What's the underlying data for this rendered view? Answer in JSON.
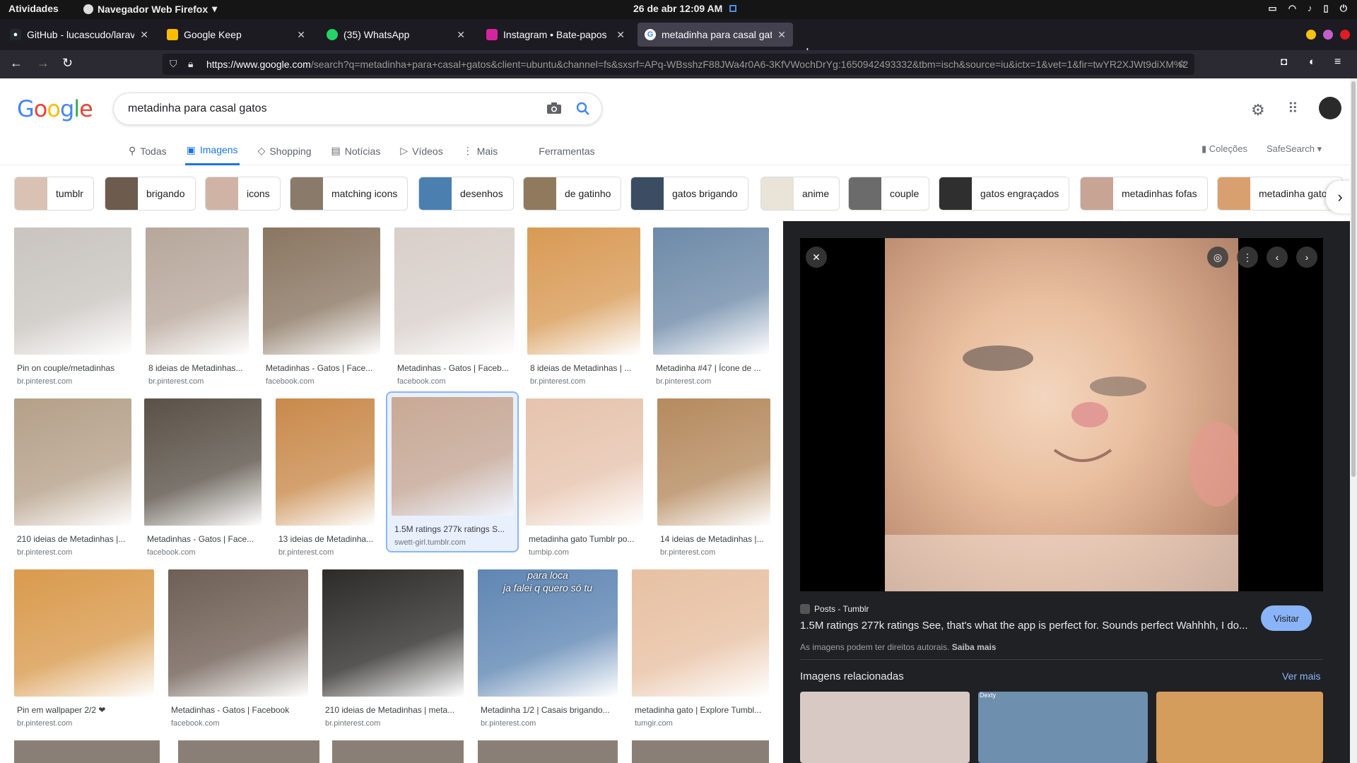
{
  "topbar": {
    "activities": "Atividades",
    "app_name": "Navegador Web Firefox",
    "clock": "26 de abr  12:09 AM"
  },
  "browser": {
    "tabs": [
      {
        "title": "GitHub - lucascudo/laravel",
        "color": "#24292f"
      },
      {
        "title": "Google Keep",
        "color": "#fbbc04"
      },
      {
        "title": "(35) WhatsApp",
        "color": "#25d366"
      },
      {
        "title": "Instagram • Bate-papos",
        "color": "#d6249f"
      },
      {
        "title": "metadinha para casal gatos",
        "color": "#4285f4"
      }
    ],
    "url_host": "https://www.google.com",
    "url_rest": "/search?q=metadinha+para+casal+gatos&client=ubuntu&channel=fs&sxsrf=APq-WBsshzF88JWa4r0A6-3KfVWochDrYg:1650942493332&tbm=isch&source=iu&ictx=1&vet=1&fir=twYR2XJWt9diXM%2"
  },
  "google": {
    "logo": "Google",
    "query": "metadinha para casal gatos",
    "tabs": [
      "Todas",
      "Imagens",
      "Shopping",
      "Notícias",
      "Vídeos",
      "Mais"
    ],
    "tools": "Ferramentas",
    "collections": "Coleções",
    "safesearch": "SafeSearch"
  },
  "chips": [
    {
      "label": "tumblr",
      "color": "#d9c2b4"
    },
    {
      "label": "brigando",
      "color": "#6d5b4e"
    },
    {
      "label": "icons",
      "color": "#cfb3a5"
    },
    {
      "label": "matching icons",
      "color": "#8a7a6a"
    },
    {
      "label": "desenhos",
      "color": "#4b7fb0"
    },
    {
      "label": "de gatinho",
      "color": "#8f7a5e"
    },
    {
      "label": "gatos brigando",
      "color": "#3b4c63"
    },
    {
      "label": "anime",
      "color": "#e9e3d8"
    },
    {
      "label": "couple",
      "color": "#6b6b6b"
    },
    {
      "label": "gatos engraçados",
      "color": "#2f2f2f"
    },
    {
      "label": "metadinhas fofas",
      "color": "#c7a493"
    },
    {
      "label": "metadinha gatos",
      "color": "#d9a06f"
    }
  ],
  "results": [
    {
      "caption": "Pin on couple/metadinhas",
      "source": "br.pinterest.com",
      "color": "#c9c4bf"
    },
    {
      "caption": "8 ideias de Metadinhas...",
      "source": "br.pinterest.com",
      "color": "#b7a79b"
    },
    {
      "caption": "Metadinhas - Gatos | Face...",
      "source": "facebook.com",
      "color": "#8a7662"
    },
    {
      "caption": "Metadinhas - Gatos | Faceb...",
      "source": "facebook.com",
      "color": "#d8cfca"
    },
    {
      "caption": "8 ideias de Metadinhas | ...",
      "source": "br.pinterest.com",
      "color": "#d89a55"
    },
    {
      "caption": "Metadinha #47 | Ícone de ...",
      "source": "br.pinterest.com",
      "color": "#6e8aa8"
    },
    {
      "caption": "210 ideias de Metadinhas |...",
      "source": "br.pinterest.com",
      "color": "#b5a089"
    },
    {
      "caption": "Metadinhas - Gatos | Face...",
      "source": "facebook.com",
      "color": "#5a5248"
    },
    {
      "caption": "13 ideias de Metadinha...",
      "source": "br.pinterest.com",
      "color": "#c98a4b"
    },
    {
      "caption": "1.5M ratings 277k ratings S...",
      "source": "swett-girl.tumblr.com",
      "color": "#c9a995"
    },
    {
      "caption": "metadinha gato Tumblr po...",
      "source": "tumbip.com",
      "color": "#e6c3ad"
    },
    {
      "caption": "14 ideias de Metadinhas |...",
      "source": "br.pinterest.com",
      "color": "#b58a5e"
    },
    {
      "caption": "Pin em wallpaper 2/2 ❤",
      "source": "br.pinterest.com",
      "color": "#d99a4d"
    },
    {
      "caption": "Metadinhas - Gatos | Facebook",
      "source": "facebook.com",
      "color": "#6f5f55"
    },
    {
      "caption": "210 ideias de Metadinhas | meta...",
      "source": "br.pinterest.com",
      "color": "#2d2b2a"
    },
    {
      "caption": "Metadinha 1/2 | Casais brigando...",
      "source": "br.pinterest.com",
      "color": "#5f86b3"
    },
    {
      "caption": "metadinha gato | Explore Tumbl...",
      "source": "tumgir.com",
      "color": "#e7c0a2"
    }
  ],
  "overlay_text": {
    "line1": "para loca",
    "line2": "ja falei q quero só tu"
  },
  "panel": {
    "source": "Posts - Tumblr",
    "title": "1.5M ratings 277k ratings See, that's what the app is perfect for. Sounds perfect Wahhhh, I do...",
    "visit": "Visitar",
    "rights": "As imagens podem ter direitos autorais.",
    "learn_more": "Saiba mais",
    "related_title": "Imagens relacionadas",
    "see_more": "Ver mais",
    "related_watermark": "Dexty",
    "related_colors": [
      "#d8c9c4",
      "#6e8fae",
      "#d49d5c"
    ]
  }
}
